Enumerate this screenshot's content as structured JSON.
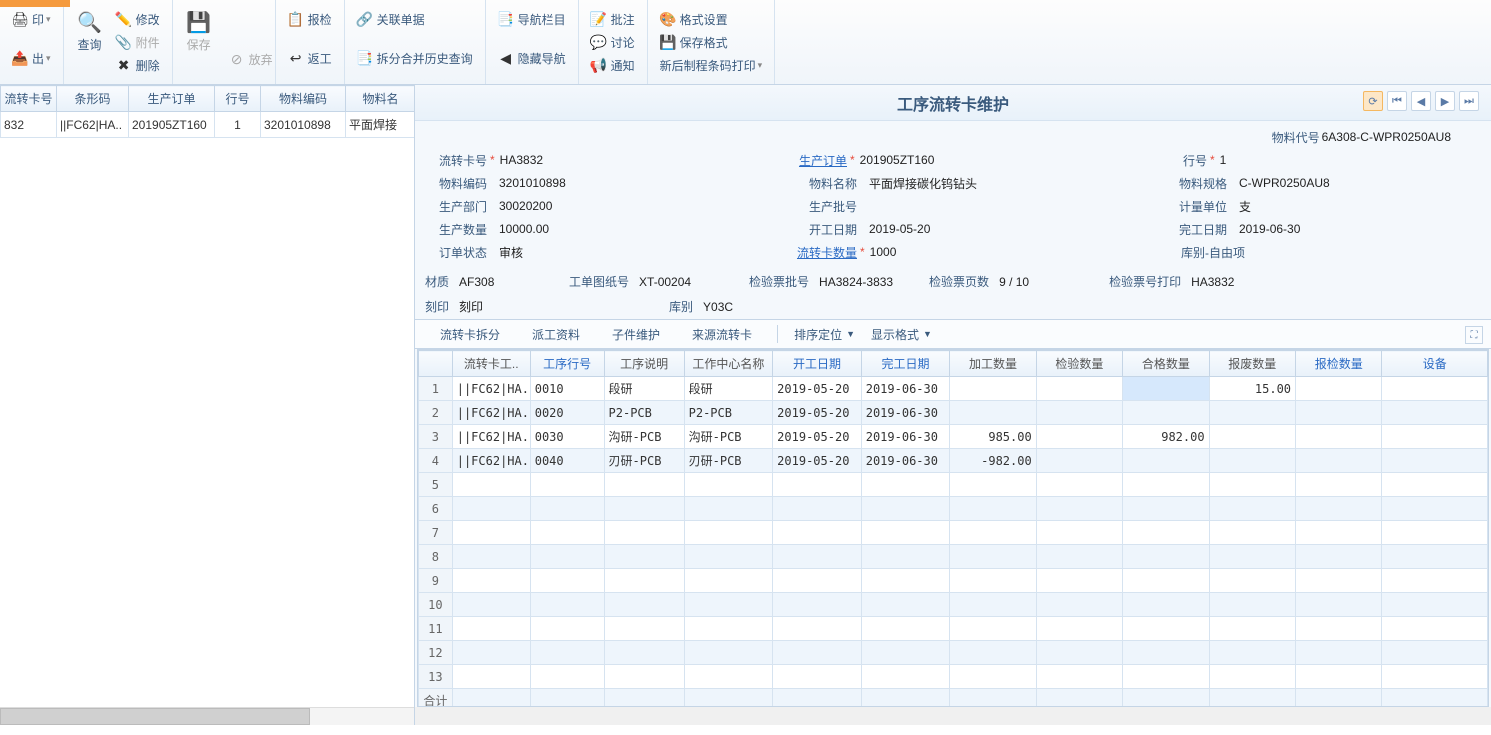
{
  "ribbon": {
    "print": "印",
    "export": "出",
    "query": "查询",
    "modify": "修改",
    "attach": "附件",
    "del": "删除",
    "discard": "放弃",
    "save": "保存",
    "inspect": "报检",
    "return_work": "返工",
    "assoc": "关联单据",
    "split_hist": "拆分合并历史查询",
    "nav_bar": "导航栏目",
    "hide_nav": "隐藏导航",
    "remark": "批注",
    "discuss": "讨论",
    "notify": "通知",
    "format_set": "格式设置",
    "save_format": "保存格式",
    "barcode_print": "新后制程条码打印"
  },
  "left_grid": {
    "cols": [
      "流转卡号",
      "条形码",
      "生产订单",
      "行号",
      "物料编码",
      "物料名"
    ],
    "row": {
      "c0": "832",
      "c1": "||FC62|HA..",
      "c2": "201905ZT160",
      "c3": "1",
      "c4": "3201010898",
      "c5": "平面焊接"
    }
  },
  "title": "工序流转卡维护",
  "form": {
    "material_code_l": "物料代号",
    "material_code_v": "6A308-C-WPR0250AU8",
    "card_no_l": "流转卡号",
    "card_no_v": "HA3832",
    "prod_order_l": "生产订单",
    "prod_order_v": "201905ZT160",
    "row_no_l": "行号",
    "row_no_v": "1",
    "mat_code_l": "物料编码",
    "mat_code_v": "3201010898",
    "mat_name_l": "物料名称",
    "mat_name_v": "平面焊接碳化钨钻头",
    "mat_spec_l": "物料规格",
    "mat_spec_v": "C-WPR0250AU8",
    "prod_dept_l": "生产部门",
    "prod_dept_v": "30020200",
    "prod_batch_l": "生产批号",
    "prod_batch_v": "",
    "unit_l": "计量单位",
    "unit_v": "支",
    "prod_qty_l": "生产数量",
    "prod_qty_v": "10000.00",
    "start_date_l": "开工日期",
    "start_date_v": "2019-05-20",
    "end_date_l": "完工日期",
    "end_date_v": "2019-06-30",
    "status_l": "订单状态",
    "status_v": "审核",
    "card_qty_l": "流转卡数量",
    "card_qty_v": "1000",
    "store_free_l": "库别-自由项",
    "material_l": "材质",
    "material_v": "AF308",
    "drawing_l": "工单图纸号",
    "drawing_v": "XT-00204",
    "insp_batch_l": "检验票批号",
    "insp_batch_v": "HA3824-3833",
    "insp_page_l": "检验票页数",
    "insp_page_v": "9 / 10",
    "insp_print_l": "检验票号打印",
    "insp_print_v": "HA3832",
    "mark_l": "刻印",
    "mark_v": "刻印",
    "store_l": "库别",
    "store_v": "Y03C"
  },
  "tabs": {
    "t1": "流转卡拆分",
    "t2": "派工资料",
    "t3": "子件维护",
    "t4": "来源流转卡",
    "sort": "排序定位",
    "disp": "显示格式"
  },
  "detail": {
    "cols": [
      "",
      "流转卡工..",
      "工序行号",
      "工序说明",
      "工作中心名称",
      "开工日期",
      "完工日期",
      "加工数量",
      "检验数量",
      "合格数量",
      "报废数量",
      "报检数量",
      "设备"
    ],
    "rows": [
      {
        "n": "1",
        "b": "||FC62|HA..",
        "op": "0010",
        "d": "段研",
        "wc": "段研",
        "sd": "2019-05-20",
        "ed": "2019-06-30",
        "pq": "",
        "iq": "",
        "gq": "",
        "sq": "15.00",
        "rq": "",
        "eq": ""
      },
      {
        "n": "2",
        "b": "||FC62|HA..",
        "op": "0020",
        "d": "P2-PCB",
        "wc": "P2-PCB",
        "sd": "2019-05-20",
        "ed": "2019-06-30",
        "pq": "",
        "iq": "",
        "gq": "",
        "sq": "",
        "rq": "",
        "eq": ""
      },
      {
        "n": "3",
        "b": "||FC62|HA..",
        "op": "0030",
        "d": "沟研-PCB",
        "wc": "沟研-PCB",
        "sd": "2019-05-20",
        "ed": "2019-06-30",
        "pq": "985.00",
        "iq": "",
        "gq": "982.00",
        "sq": "",
        "rq": "",
        "eq": ""
      },
      {
        "n": "4",
        "b": "||FC62|HA..",
        "op": "0040",
        "d": "刃研-PCB",
        "wc": "刃研-PCB",
        "sd": "2019-05-20",
        "ed": "2019-06-30",
        "pq": "-982.00",
        "iq": "",
        "gq": "",
        "sq": "",
        "rq": "",
        "eq": ""
      }
    ],
    "footer": "合计"
  }
}
